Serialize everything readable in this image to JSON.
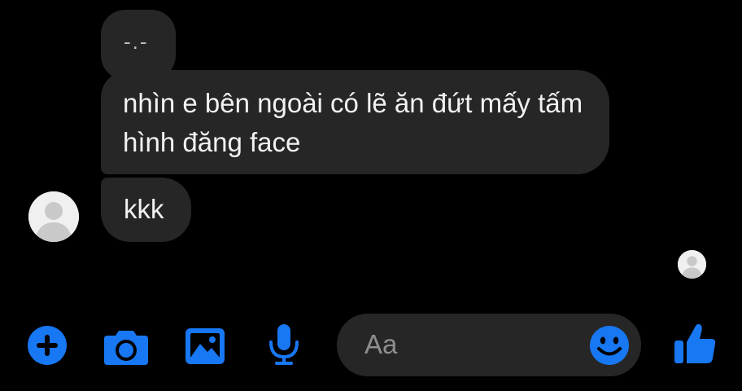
{
  "conversation": {
    "messages": [
      {
        "sender": "contact",
        "text": "-.-"
      },
      {
        "sender": "contact",
        "text": "nhìn e bên ngoài có lẽ ăn đứt mấy tấm hình đăng face"
      },
      {
        "sender": "contact",
        "text": "kkk"
      }
    ],
    "bubble_color": "#262626"
  },
  "composer": {
    "placeholder": "Aa",
    "value": ""
  },
  "toolbar": {
    "icons": [
      "plus-icon",
      "camera-icon",
      "photo-icon",
      "microphone-icon",
      "emoji-icon",
      "thumbs-up-icon"
    ],
    "accent_color": "#1877f2"
  }
}
